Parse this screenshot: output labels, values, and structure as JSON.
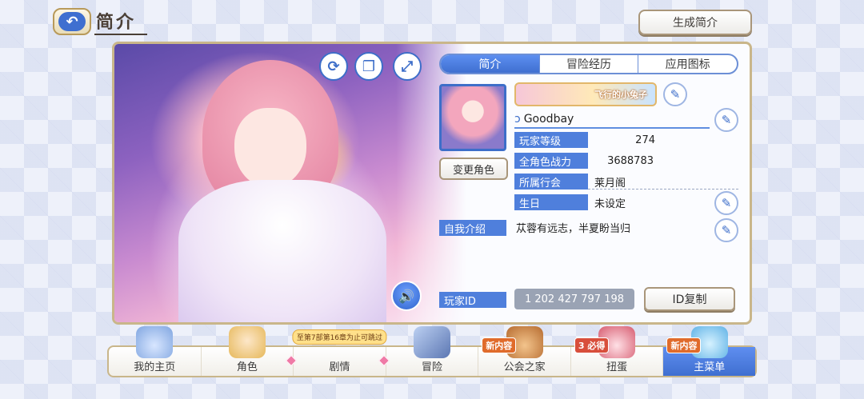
{
  "header": {
    "title": "简介",
    "back_label": "↶",
    "generate_button": "生成简介"
  },
  "art_controls": {
    "rotate_icon": "⟳",
    "copy_icon": "❐",
    "expand_icon": "⤢",
    "sound_icon": "🔊"
  },
  "tabs": [
    {
      "label": "简介",
      "active": true
    },
    {
      "label": "冒险经历",
      "active": false
    },
    {
      "label": "应用图标",
      "active": false
    }
  ],
  "profile": {
    "change_character_button": "变更角色",
    "title_banner": "飞行的小兔子",
    "name": "Goodbay",
    "rows": [
      {
        "label": "玩家等级",
        "value": "274"
      },
      {
        "label": "全角色战力",
        "value": "3688783"
      },
      {
        "label": "所属行会",
        "value": "莱月阁"
      },
      {
        "label": "生日",
        "value": "未设定"
      }
    ],
    "intro_label": "自我介绍",
    "intro_text": "苁蓉有远志，半夏盼当归",
    "player_id_label": "玩家ID",
    "player_id_value": "1 202 427 797 198",
    "copy_id_button": "ID复制"
  },
  "nav": {
    "items": [
      {
        "label": "我的主页",
        "badge": ""
      },
      {
        "label": "角色",
        "badge": ""
      },
      {
        "label": "剧情",
        "badge": "至第7部第16章为止可跳过"
      },
      {
        "label": "冒险",
        "badge": ""
      },
      {
        "label": "公会之家",
        "badge": "新内容"
      },
      {
        "label": "扭蛋",
        "badge": "3 必得"
      },
      {
        "label": "主菜单",
        "badge": "新内容"
      }
    ]
  },
  "colors": {
    "accent_blue": "#3f6fd0",
    "label_blue": "#4f7fdc",
    "gold_border": "#c9b68a"
  }
}
